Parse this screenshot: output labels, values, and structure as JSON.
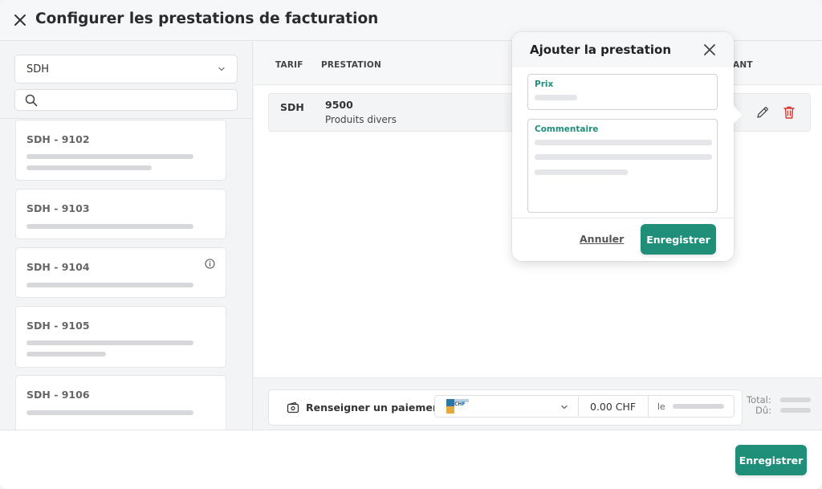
{
  "header": {
    "title": "Configurer les prestations de facturation"
  },
  "sidebar": {
    "select_value": "SDH",
    "search_placeholder": "",
    "items": [
      {
        "title": "SDH - 9102",
        "has_info": false
      },
      {
        "title": "SDH - 9103",
        "has_info": false
      },
      {
        "title": "SDH - 9104",
        "has_info": true
      },
      {
        "title": "SDH - 9105",
        "has_info": false
      },
      {
        "title": "SDH - 9106",
        "has_info": false
      }
    ]
  },
  "table": {
    "columns": [
      "TARIF",
      "PRESTATION",
      "ANT"
    ],
    "rows": [
      {
        "tarif": "SDH",
        "code": "9500",
        "description": "Produits divers"
      }
    ]
  },
  "payment": {
    "label": "Renseigner un paiement",
    "currency": "CHF",
    "amount": "0.00 CHF",
    "date_prefix": "le",
    "total_label": "Total:",
    "due_label": "Dû:"
  },
  "footer": {
    "save_label": "Enregistrer"
  },
  "popover": {
    "title": "Ajouter la prestation",
    "price_label": "Prix",
    "comment_label": "Commentaire",
    "cancel_label": "Annuler",
    "save_label": "Enregistrer"
  },
  "colors": {
    "accent": "#1f8f7a",
    "danger": "#d9342b",
    "placeholder_bar": "#d6d8dc"
  },
  "icons": [
    "close-icon",
    "chevron-down-icon",
    "search-icon",
    "info-icon",
    "pencil-icon",
    "trash-icon",
    "wallet-icon",
    "chf-flag-icon"
  ]
}
